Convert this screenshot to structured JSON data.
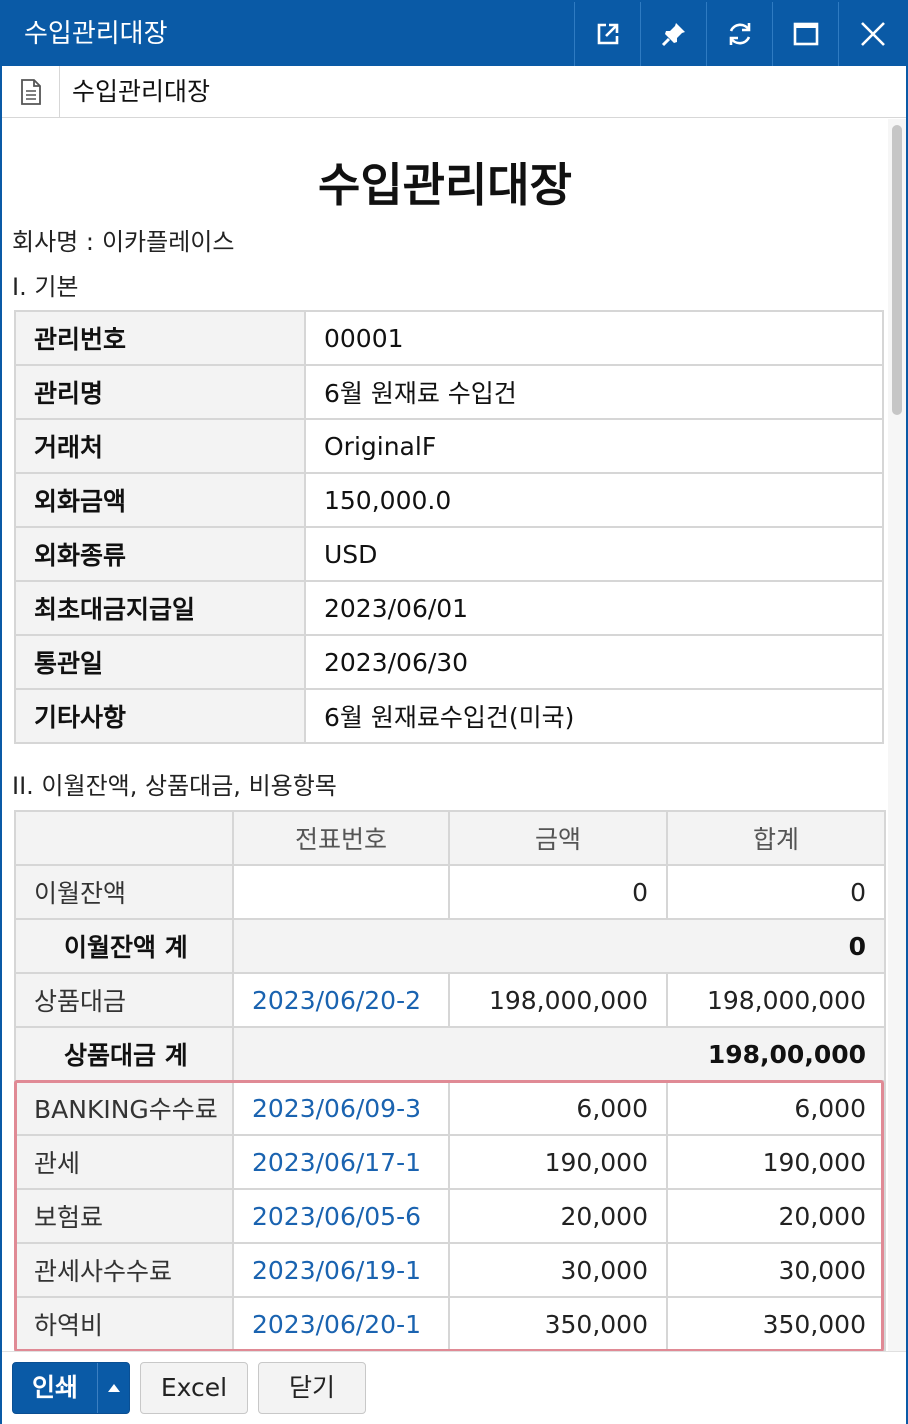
{
  "window": {
    "title": "수입관리대장"
  },
  "toolbar": {
    "icons": [
      "external-link-icon",
      "pin-icon",
      "refresh-icon",
      "maximize-icon",
      "close-icon"
    ]
  },
  "tab": {
    "title": "수입관리대장",
    "icon": "document-icon"
  },
  "doc": {
    "title": "수입관리대장",
    "company_label": "회사명 :",
    "company_name": "이카플레이스",
    "section1": "I. 기본",
    "section2": "II. 이월잔액, 상품대금, 비용항목"
  },
  "basic": {
    "rows": [
      {
        "label": "관리번호",
        "value": "00001"
      },
      {
        "label": "관리명",
        "value": "6월 원재료 수입건"
      },
      {
        "label": "거래처",
        "value": "OriginalF"
      },
      {
        "label": "외화금액",
        "value": "150,000.0"
      },
      {
        "label": "외화종류",
        "value": "USD"
      },
      {
        "label": "최초대금지급일",
        "value": "2023/06/01"
      },
      {
        "label": "통관일",
        "value": "2023/06/30"
      },
      {
        "label": "기타사항",
        "value": "6월 원재료수입건(미국)"
      }
    ]
  },
  "ledger": {
    "headers": [
      "",
      "전표번호",
      "금액",
      "합계"
    ],
    "carry": {
      "label": "이월잔액",
      "voucher": "",
      "amount": "0",
      "total": "0"
    },
    "carry_sub": {
      "label": "이월잔액 계",
      "total": "0"
    },
    "goods": {
      "label": "상품대금",
      "voucher": "2023/06/20-2",
      "amount": "198,000,000",
      "total": "198,000,000"
    },
    "goods_sub": {
      "label": "상품대금 계",
      "total": "198,00,000"
    },
    "expenses": [
      {
        "label": "BANKING수수료",
        "voucher": "2023/06/09-3",
        "amount": "6,000",
        "total": "6,000"
      },
      {
        "label": "관세",
        "voucher": "2023/06/17-1",
        "amount": "190,000",
        "total": "190,000"
      },
      {
        "label": "보험료",
        "voucher": "2023/06/05-6",
        "amount": "20,000",
        "total": "20,000"
      },
      {
        "label": "관세사수수료",
        "voucher": "2023/06/19-1",
        "amount": "30,000",
        "total": "30,000"
      },
      {
        "label": "하역비",
        "voucher": "2023/06/20-1",
        "amount": "350,000",
        "total": "350,000"
      }
    ]
  },
  "footer": {
    "print_label": "인쇄",
    "excel_label": "Excel",
    "close_label": "닫기"
  },
  "colors": {
    "primary": "#0a5aa6",
    "link": "#1a63b0",
    "highlight_border": "#e08a95",
    "label_bg": "#f3f3f3",
    "grid": "#d6d6d6"
  }
}
